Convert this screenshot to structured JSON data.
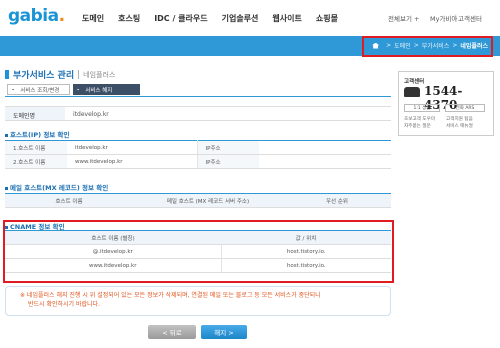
{
  "logo": {
    "text": "gabia",
    "dot": "."
  },
  "gnb": [
    "도메인",
    "호스팅",
    "IDC / 클라우드",
    "기업솔루션",
    "웹사이트",
    "쇼핑몰"
  ],
  "util": {
    "all": "전체보기 +",
    "my": "My가비아",
    "cs": "고객센터",
    "sep": "|"
  },
  "breadcrumb": {
    "items": [
      "도메인",
      "부가서비스"
    ],
    "current": "네임플러스",
    "sep": ">"
  },
  "page": {
    "title": "부가서비스 관리",
    "title_sep": "|",
    "subtitle": "네임플러스",
    "tabs": [
      {
        "prefix": "-",
        "label": "서비스 조회/변경"
      },
      {
        "prefix": "-",
        "label": "서비스 해지"
      }
    ]
  },
  "domain": {
    "label": "도메인명",
    "value": "itdevelop.kr"
  },
  "host_section": {
    "title": "호스트(IP) 정보 확인",
    "rows": [
      {
        "name_label": "1.호스트 이름",
        "name": "itdevelop.kr",
        "ip_label": "IP주소",
        "ip": ""
      },
      {
        "name_label": "2.호스트 이름",
        "name": "www.itdevelop.kr",
        "ip_label": "IP주소",
        "ip": ""
      }
    ]
  },
  "mx_section": {
    "title": "메일 호스트(MX 레코드) 정보 확인",
    "headers": [
      "호스트 이름",
      "메일 호스트 (MX 레코드 서버 주소)",
      "우선 순위"
    ]
  },
  "cname_section": {
    "title": "CNAME 정보 확인",
    "headers": [
      "호스트 이름 (별칭)",
      "값 / 위치"
    ],
    "rows": [
      [
        "@.itdevelop.kr",
        "host.tistory.io."
      ],
      [
        "www.itdevelop.kr",
        "host.tistory.io."
      ]
    ]
  },
  "notice": {
    "line1": "※ 네임플러스 해지 진행 시 위 설정되어 있는 모든 정보가 삭제되며, 연결된 메일 또는 블로그 등 모든 서비스가 중단되니",
    "line2": "반드시 확인하시기 바랍니다."
  },
  "buttons": {
    "prev": "< 뒤로",
    "cancel": "해지 >"
  },
  "cs_box": {
    "title": "고객센터",
    "phone": "1544-4370",
    "btn_chat": "1:1 상담",
    "btn_ars": "전화 ARS",
    "links": [
      "초보고객 도우미",
      "고객지원 팁음",
      "자주묻는 질문",
      "서비스 매뉴얼"
    ]
  },
  "colors": {
    "accent": "#2f98d6",
    "highlight": "#e11b22",
    "notice": "#e0531b"
  }
}
